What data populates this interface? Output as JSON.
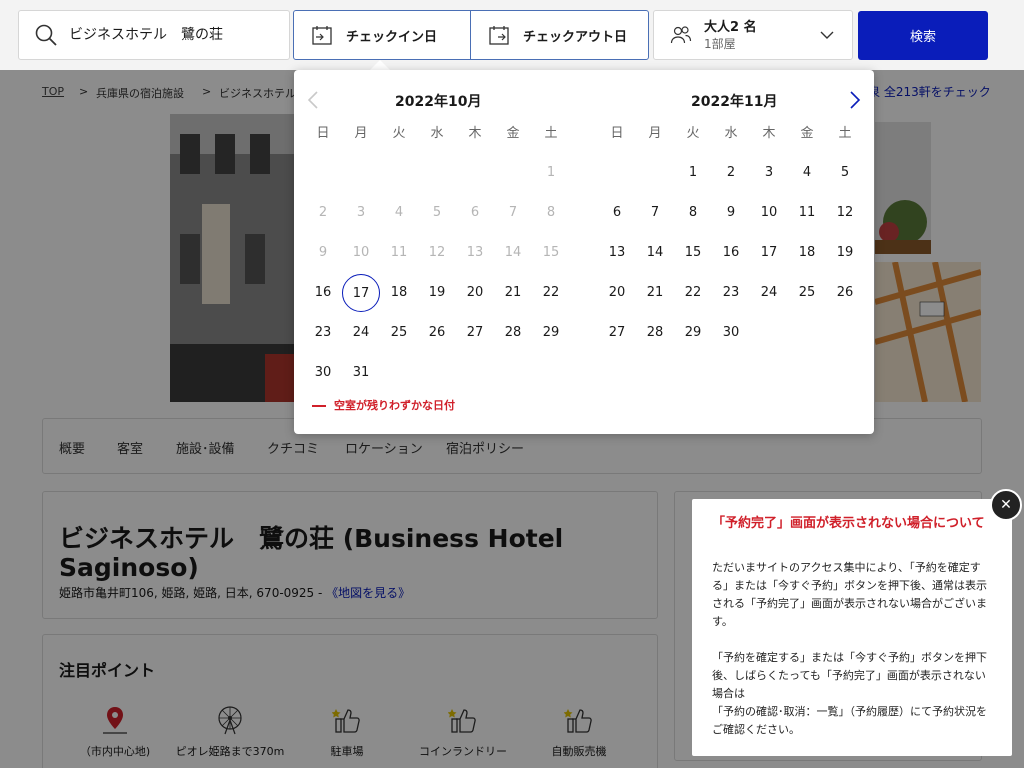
{
  "search": {
    "query": "ビジネスホテル　鷺の荘"
  },
  "dates": {
    "checkin_label": "チェックイン日",
    "checkout_label": "チェックアウト日"
  },
  "guests": {
    "adults": "大人2 名",
    "rooms": "1部屋"
  },
  "search_button": "検索",
  "breadcrumb": [
    "TOP",
    ">",
    "兵庫県の宿泊施設",
    ">",
    "ビジネスホテル"
  ],
  "hotels_link": "泉 全213軒をチェック",
  "calendar": {
    "weekdays": [
      "日",
      "月",
      "火",
      "水",
      "木",
      "金",
      "土"
    ],
    "months": [
      {
        "title": "2022年10月",
        "days": [
          {
            "day": "1",
            "past": true
          },
          {
            "day": "2",
            "past": true
          },
          {
            "day": "3",
            "past": true
          },
          {
            "day": "4",
            "past": true
          },
          {
            "day": "5",
            "past": true
          },
          {
            "day": "6",
            "past": true
          },
          {
            "day": "7",
            "past": true
          },
          {
            "day": "8",
            "past": true
          },
          {
            "day": "9",
            "past": true
          },
          {
            "day": "10",
            "past": true
          },
          {
            "day": "11",
            "past": true
          },
          {
            "day": "12",
            "past": true
          },
          {
            "day": "13",
            "past": true
          },
          {
            "day": "14",
            "past": true
          },
          {
            "day": "15",
            "past": true
          },
          {
            "day": "16"
          },
          {
            "day": "17",
            "today": true
          },
          {
            "day": "18"
          },
          {
            "day": "19"
          },
          {
            "day": "20"
          },
          {
            "day": "21"
          },
          {
            "day": "22"
          },
          {
            "day": "23"
          },
          {
            "day": "24"
          },
          {
            "day": "25"
          },
          {
            "day": "26"
          },
          {
            "day": "27"
          },
          {
            "day": "28"
          },
          {
            "day": "29"
          },
          {
            "day": "30"
          },
          {
            "day": "31"
          }
        ]
      },
      {
        "title": "2022年11月",
        "days": [
          {
            "day": "1"
          },
          {
            "day": "2"
          },
          {
            "day": "3"
          },
          {
            "day": "4"
          },
          {
            "day": "5"
          },
          {
            "day": "6"
          },
          {
            "day": "7"
          },
          {
            "day": "8"
          },
          {
            "day": "9"
          },
          {
            "day": "10"
          },
          {
            "day": "11"
          },
          {
            "day": "12"
          },
          {
            "day": "13"
          },
          {
            "day": "14"
          },
          {
            "day": "15"
          },
          {
            "day": "16"
          },
          {
            "day": "17"
          },
          {
            "day": "18"
          },
          {
            "day": "19"
          },
          {
            "day": "20"
          },
          {
            "day": "21"
          },
          {
            "day": "22"
          },
          {
            "day": "23"
          },
          {
            "day": "24"
          },
          {
            "day": "25"
          },
          {
            "day": "26"
          },
          {
            "day": "27"
          },
          {
            "day": "28"
          },
          {
            "day": "29"
          },
          {
            "day": "30"
          }
        ]
      }
    ],
    "legend": "空室が残りわずかな日付"
  },
  "tabs": [
    "概要",
    "客室",
    "施設･設備",
    "クチコミ",
    "ロケーション",
    "宿泊ポリシー"
  ],
  "hotel": {
    "name": "ビジネスホテル　鷺の荘 (Business Hotel Saginoso)",
    "address": "姫路市亀井町106, 姫路, 姫路, 日本, 670-0925 - ",
    "map_link": "《地図を見る》"
  },
  "features": {
    "title": "注目ポイント",
    "items": [
      {
        "icon": "map-pin-icon",
        "label": "（市内中心地)"
      },
      {
        "icon": "ferris-wheel-icon",
        "label": "ピオレ姫路まで370m"
      },
      {
        "icon": "thumbs-up-icon",
        "label": "駐車場"
      },
      {
        "icon": "thumbs-up-icon",
        "label": "コインランドリー"
      },
      {
        "icon": "thumbs-up-icon",
        "label": "自動販売機"
      }
    ]
  },
  "popup": {
    "title": "「予約完了」画面が表示されない場合について",
    "paragraphs": [
      "ただいまサイトのアクセス集中により､「予約を確定する」または「今すぐ予約」ボタンを押下後、通常は表示される「予約完了」画面が表示されない場合がございます。",
      "「予約を確定する」または「今すぐ予約」ボタンを押下後、しばらくたっても「予約完了」画面が表示されない場合は",
      "「予約の確認･取消：一覧」（予約履歴）にて予約状況をご確認ください。"
    ]
  },
  "colors": {
    "accent": "#0a1dba",
    "alert": "#d0202a"
  }
}
